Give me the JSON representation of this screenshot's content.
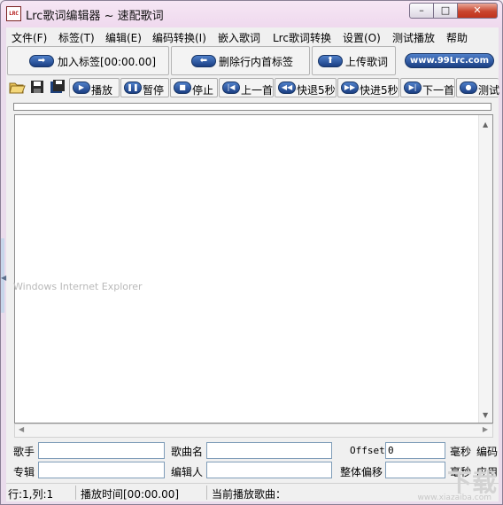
{
  "window": {
    "title": "Lrc歌词编辑器 ~ 速配歌词",
    "icon_text": "LRC",
    "controls": {
      "minimize": "–",
      "maximize": "□",
      "close": "✕"
    }
  },
  "menu": [
    "文件(F)",
    "标签(T)",
    "编辑(E)",
    "编码转换(I)",
    "嵌入歌词",
    "Lrc歌词转换",
    "设置(O)",
    "测试播放",
    "帮助"
  ],
  "bigbar": {
    "add_tag": "加入标签[00:00.00]",
    "delete_tag": "删除行内首标签",
    "upload": "上传歌词",
    "site": "www.99Lrc.com"
  },
  "toolbar": {
    "play": "播放",
    "pause": "暂停",
    "stop": "停止",
    "prev": "上一首",
    "rewind": "快退5秒",
    "forward": "快进5秒",
    "next": "下一首",
    "test": "测试"
  },
  "ghost_text": "Windows Internet Explorer",
  "fields": {
    "artist_label": "歌手",
    "artist_value": "",
    "song_label": "歌曲名",
    "song_value": "",
    "offset_label": "Offset",
    "offset_value": "0",
    "ms_label_1": "毫秒",
    "encode_label": "编码",
    "album_label": "专辑",
    "album_value": "",
    "editor_label": "编辑人",
    "editor_value": "",
    "shift_label": "整体偏移",
    "shift_value": "",
    "ms_label_2": "毫秒",
    "apply_label": "应用"
  },
  "status": {
    "position": "行:1,列:1",
    "play_time": "播放时间[00:00.00]",
    "current_song": "当前播放歌曲："
  },
  "watermark": {
    "text": "下载",
    "sub": "www.xiazaiba.com"
  }
}
